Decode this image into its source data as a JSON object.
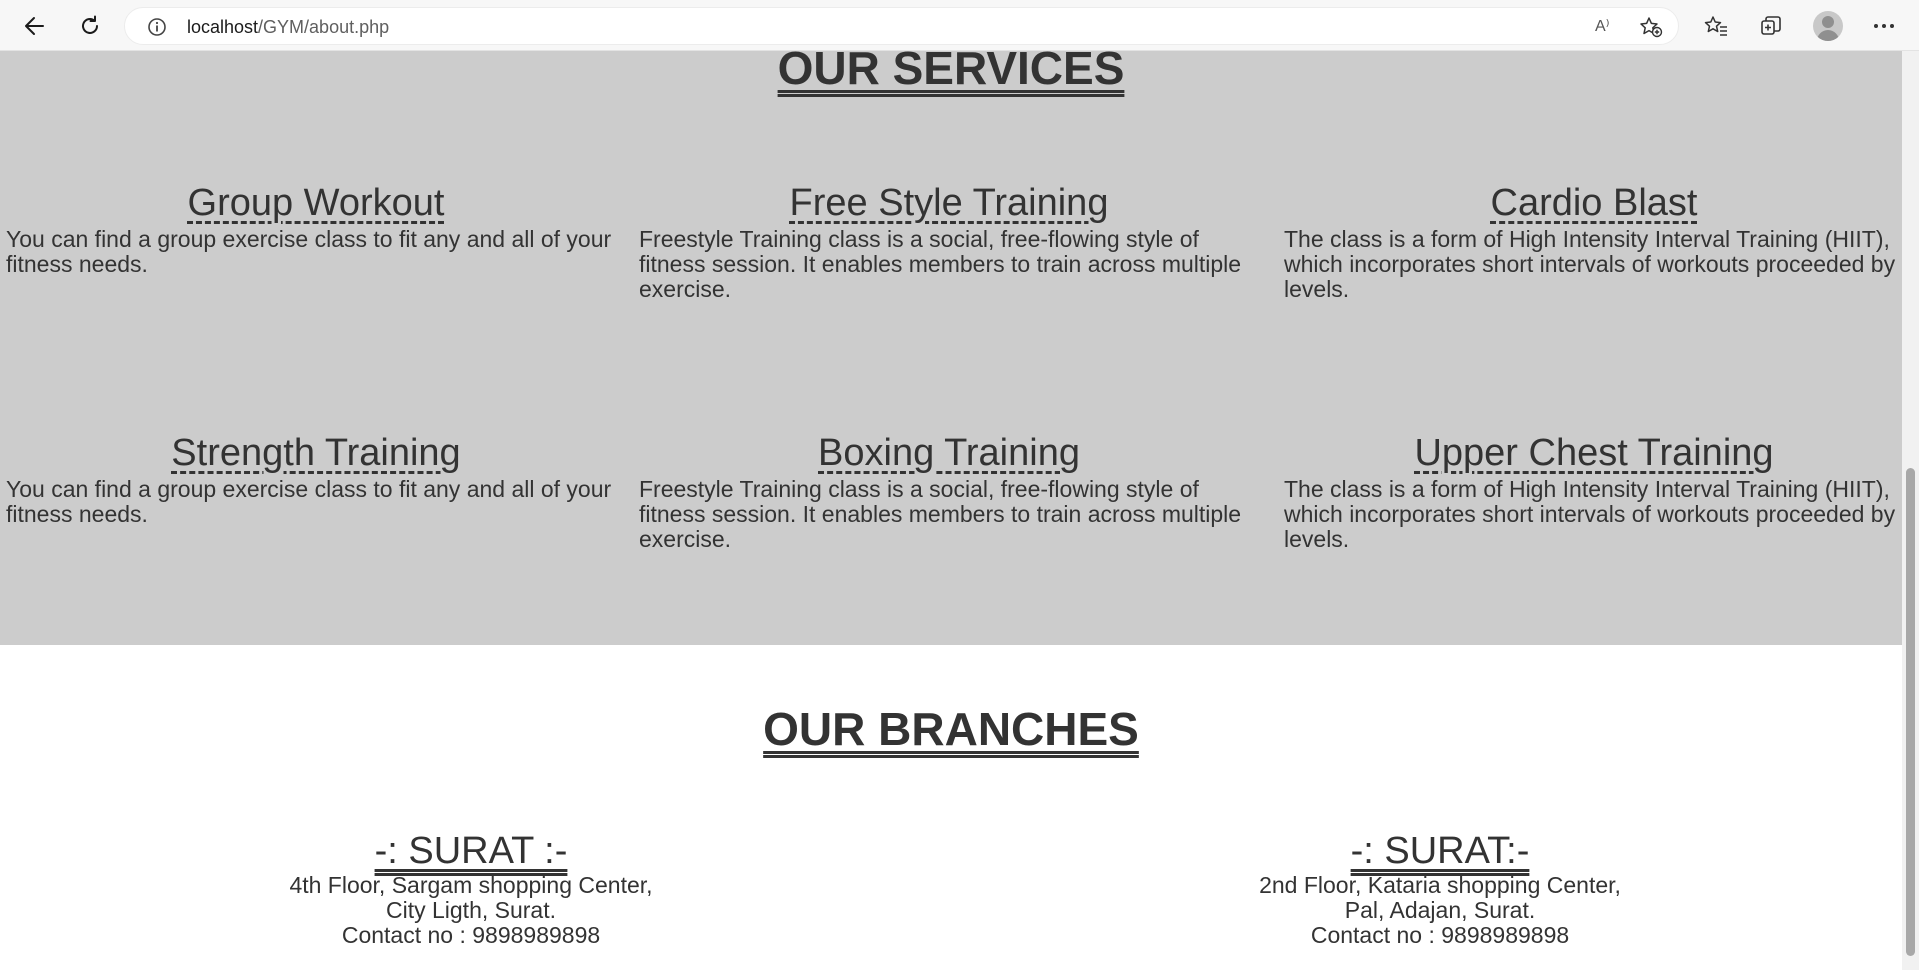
{
  "browser": {
    "url_host": "localhost",
    "url_path": "/GYM/about.php",
    "read_aloud_label": "A⁾"
  },
  "services": {
    "title": "OUR SERVICES",
    "items": [
      {
        "title": "Group Workout",
        "text": "You can find a group exercise class to fit any and all of your fitness needs."
      },
      {
        "title": "Free Style Training",
        "text": "Freestyle Training class is a social, free-flowing style of fitness session. It enables members to train across multiple exercise."
      },
      {
        "title": "Cardio Blast",
        "text": "The class is a form of High Intensity Interval Training (HIIT), which incorporates short intervals of workouts proceeded by levels."
      },
      {
        "title": "Strength Training",
        "text": "You can find a group exercise class to fit any and all of your fitness needs."
      },
      {
        "title": "Boxing Training",
        "text": "Freestyle Training class is a social, free-flowing style of fitness session. It enables members to train across multiple exercise."
      },
      {
        "title": "Upper Chest Training",
        "text": "The class is a form of High Intensity Interval Training (HIIT), which incorporates short intervals of workouts proceeded by levels."
      }
    ]
  },
  "branches": {
    "title": "OUR BRANCHES",
    "items": [
      {
        "name": "-: SURAT :-",
        "line1": "4th Floor, Sargam shopping Center,",
        "line2": "City Ligth, Surat.",
        "contact": "Contact no : 9898989898"
      },
      {
        "name": "-: SURAT:-",
        "line1": "2nd Floor, Kataria shopping Center,",
        "line2": "Pal, Adajan, Surat.",
        "contact": "Contact no : 9898989898"
      }
    ]
  },
  "colors": {
    "services_bg": "#cccccc",
    "text": "#333333",
    "chrome_bg": "#f7f7f7"
  }
}
